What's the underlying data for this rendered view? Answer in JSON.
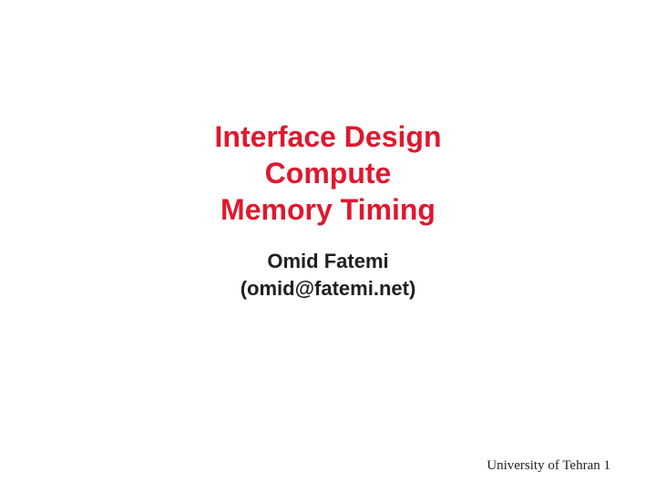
{
  "title": {
    "line1": "Interface Design",
    "line2": "Compute",
    "line3": "Memory Timing"
  },
  "author": {
    "name": "Omid Fatemi",
    "email": "(omid@fatemi.net)"
  },
  "footer": "University of Tehran 1"
}
